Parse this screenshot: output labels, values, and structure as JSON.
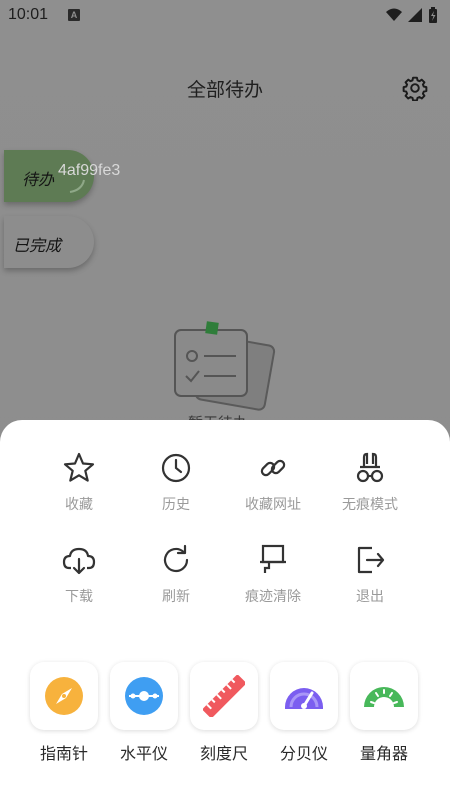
{
  "status_bar": {
    "time": "10:01",
    "notification_badge": "A"
  },
  "header": {
    "title": "全部待办"
  },
  "tabs": {
    "todo": "待办",
    "done": "已完成"
  },
  "overlay_id": "4af99fe3",
  "empty_state": {
    "text": "暂无待办"
  },
  "menu": {
    "items": [
      {
        "label": "收藏",
        "icon": "star-icon"
      },
      {
        "label": "历史",
        "icon": "clock-icon"
      },
      {
        "label": "收藏网址",
        "icon": "link-icon"
      },
      {
        "label": "无痕模式",
        "icon": "incognito-icon"
      },
      {
        "label": "下载",
        "icon": "cloud-download-icon"
      },
      {
        "label": "刷新",
        "icon": "refresh-icon"
      },
      {
        "label": "痕迹清除",
        "icon": "brush-icon"
      },
      {
        "label": "退出",
        "icon": "exit-icon"
      }
    ]
  },
  "tools": [
    {
      "label": "指南针",
      "icon": "compass-icon",
      "color": "#f7b23d"
    },
    {
      "label": "水平仪",
      "icon": "level-icon",
      "color": "#3f9ef2"
    },
    {
      "label": "刻度尺",
      "icon": "ruler-icon",
      "color": "#f0595e"
    },
    {
      "label": "分贝仪",
      "icon": "decibel-meter-icon",
      "color": "#7b5ef0"
    },
    {
      "label": "量角器",
      "icon": "protractor-icon",
      "color": "#48b85a"
    }
  ]
}
